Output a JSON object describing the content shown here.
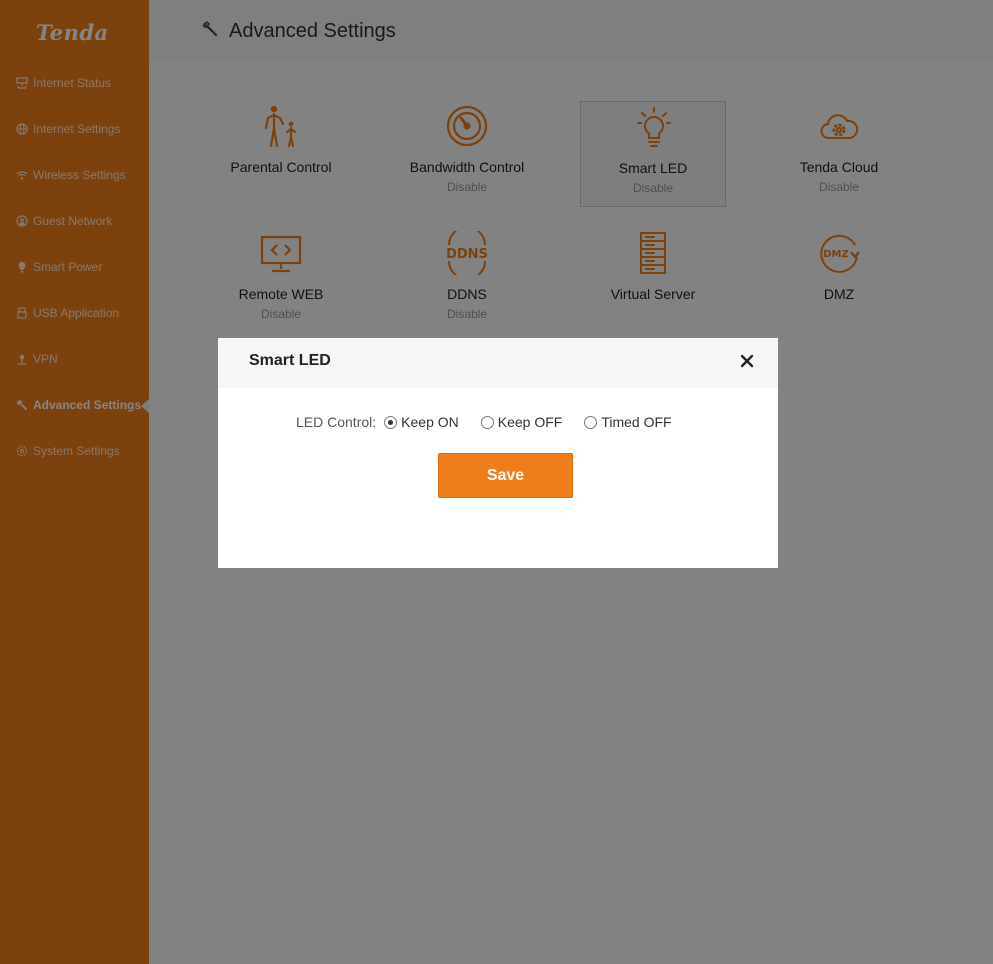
{
  "brand": {
    "logo_text": "Tenda",
    "accent": "#f07d1c"
  },
  "sidebar": {
    "items": [
      {
        "label": "Internet Status",
        "icon": "network-icon"
      },
      {
        "label": "Internet Settings",
        "icon": "globe-icon"
      },
      {
        "label": "Wireless Settings",
        "icon": "wifi-icon"
      },
      {
        "label": "Guest Network",
        "icon": "guest-icon"
      },
      {
        "label": "Smart Power",
        "icon": "power-icon"
      },
      {
        "label": "USB Application",
        "icon": "usb-icon"
      },
      {
        "label": "VPN",
        "icon": "vpn-icon"
      },
      {
        "label": "Advanced Settings",
        "icon": "wrench-icon",
        "active": true
      },
      {
        "label": "System Settings",
        "icon": "gear-icon"
      }
    ]
  },
  "header": {
    "title": "Advanced Settings",
    "icon": "wrench-icon"
  },
  "tiles": [
    {
      "label": "Parental Control",
      "sub": "",
      "icon": "parent-child-icon"
    },
    {
      "label": "Bandwidth Control",
      "sub": "Disable",
      "icon": "speedometer-icon"
    },
    {
      "label": "Smart LED",
      "sub": "Disable",
      "icon": "lightbulb-icon",
      "selected": true
    },
    {
      "label": "Tenda Cloud",
      "sub": "Disable",
      "icon": "cloud-gear-icon"
    },
    {
      "label": "Remote WEB",
      "sub": "Disable",
      "icon": "monitor-code-icon"
    },
    {
      "label": "DDNS",
      "sub": "Disable",
      "icon": "ddns-icon"
    },
    {
      "label": "Virtual Server",
      "sub": "",
      "icon": "server-icon"
    },
    {
      "label": "DMZ",
      "sub": "",
      "icon": "dmz-icon"
    }
  ],
  "modal": {
    "title": "Smart LED",
    "led_control_label": "LED Control:",
    "options": [
      {
        "label": "Keep ON",
        "checked": true
      },
      {
        "label": "Keep OFF",
        "checked": false
      },
      {
        "label": "Timed OFF",
        "checked": false
      }
    ],
    "save_label": "Save"
  }
}
